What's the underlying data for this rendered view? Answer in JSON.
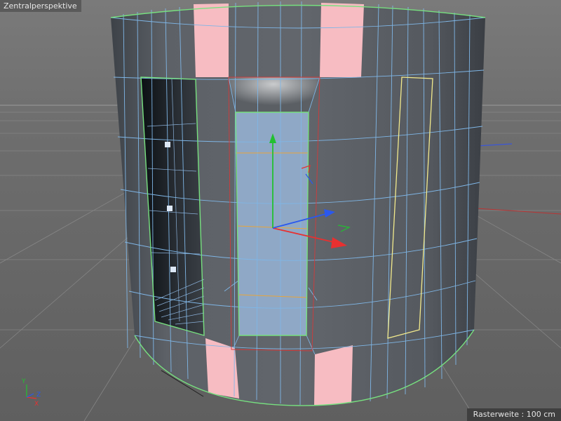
{
  "viewport": {
    "title": "Zentralperspektive",
    "grid_label": "Rasterweite",
    "grid_value": "100 cm"
  },
  "axis_indicator": {
    "x": "X",
    "y": "Y",
    "z": "Z"
  },
  "colors": {
    "background": "#6b6b6b",
    "mesh_edge": "#7fb6e6",
    "selection_outline": "#77e07f",
    "selected_face": "#8fa8c6",
    "highlight_face": "#f7bcc2",
    "selected_edge": "#f2ea8c",
    "axis_x": "#e83030",
    "axis_y": "#22c030",
    "axis_z": "#2a58ee"
  }
}
